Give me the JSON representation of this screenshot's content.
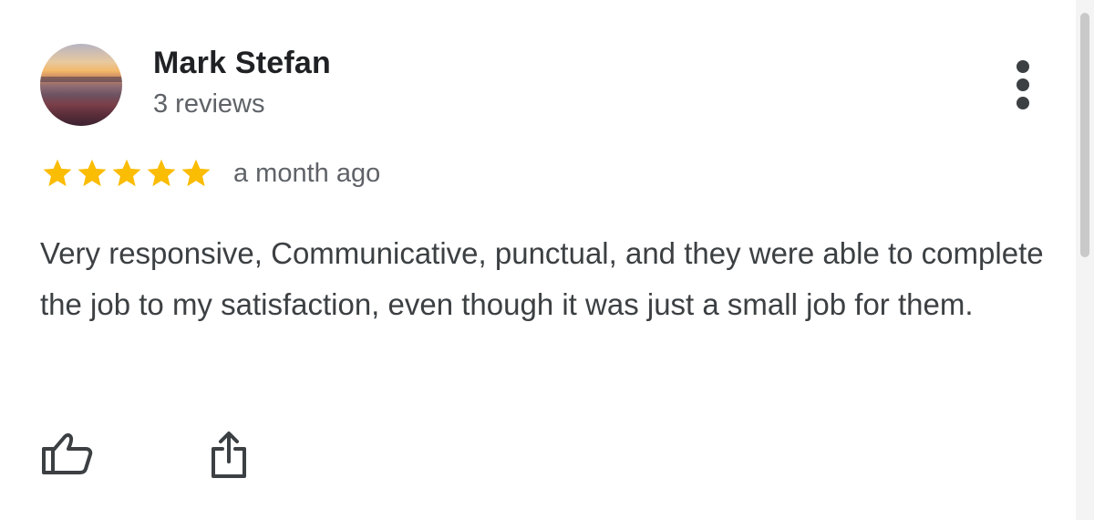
{
  "review": {
    "author": {
      "name": "Mark Stefan",
      "review_count": "3 reviews",
      "avatar_icon": "profile-photo-sunset"
    },
    "rating": {
      "stars": 5,
      "max_stars": 5,
      "star_color": "#fbbc04"
    },
    "time": "a month ago",
    "text": "Very responsive, Communicative, punctual, and they were able to complete the job to my satisfaction, even though it was just a small job for them.",
    "actions": {
      "more_icon": "more-vertical-icon",
      "like_icon": "thumbs-up-icon",
      "share_icon": "share-icon"
    }
  }
}
